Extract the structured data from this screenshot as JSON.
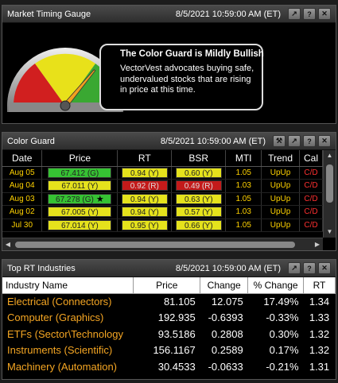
{
  "panels": {
    "gauge": {
      "title": "Market Timing Gauge",
      "timestamp": "8/5/2021 10:59:00 AM (ET)",
      "headline": "The Color Guard is Mildly Bullish",
      "body": "VectorVest advocates buying safe, undervalued stocks that are rising in price at this time.",
      "zones": [
        "red",
        "yellow",
        "green"
      ],
      "needle_level": 0.72
    },
    "color_guard": {
      "title": "Color Guard",
      "timestamp": "8/5/2021 10:59:00 AM (ET)",
      "columns": [
        "Date",
        "Price",
        "RT",
        "BSR",
        "MTI",
        "Trend",
        "Cal"
      ],
      "rows": [
        {
          "date": "Aug 05",
          "price": "67.412 (G)",
          "price_c": "g",
          "star": "",
          "rt": "0.94 (Y)",
          "rt_c": "y",
          "bsr": "0.60 (Y)",
          "bsr_c": "y",
          "mti": "1.05",
          "trend": "UpUp",
          "cal": "C/D"
        },
        {
          "date": "Aug 04",
          "price": "67.011 (Y)",
          "price_c": "y",
          "star": "",
          "rt": "0.92 (R)",
          "rt_c": "r",
          "bsr": "0.49 (R)",
          "bsr_c": "r",
          "mti": "1.03",
          "trend": "UpUp",
          "cal": "C/D"
        },
        {
          "date": "Aug 03",
          "price": "67.278 (G)",
          "price_c": "g",
          "star": "★",
          "rt": "0.94 (Y)",
          "rt_c": "y",
          "bsr": "0.63 (Y)",
          "bsr_c": "y",
          "mti": "1.05",
          "trend": "UpUp",
          "cal": "C/D"
        },
        {
          "date": "Aug 02",
          "price": "67.005 (Y)",
          "price_c": "y",
          "star": "",
          "rt": "0.94 (Y)",
          "rt_c": "y",
          "bsr": "0.57 (Y)",
          "bsr_c": "y",
          "mti": "1.03",
          "trend": "UpUp",
          "cal": "C/D"
        },
        {
          "date": "Jul 30",
          "price": "67.014 (Y)",
          "price_c": "y",
          "star": "",
          "rt": "0.95 (Y)",
          "rt_c": "y",
          "bsr": "0.66 (Y)",
          "bsr_c": "y",
          "mti": "1.05",
          "trend": "UpUp",
          "cal": "C/D"
        }
      ]
    },
    "industries": {
      "title": "Top RT Industries",
      "timestamp": "8/5/2021 10:59:00 AM (ET)",
      "columns": [
        "Industry Name",
        "Price",
        "Change",
        "% Change",
        "RT"
      ],
      "rows": [
        {
          "name": "Electrical (Connectors)",
          "price": "81.105",
          "change": "12.075",
          "pct": "17.49%",
          "rt": "1.34",
          "dir": "pos"
        },
        {
          "name": "Computer (Graphics)",
          "price": "192.935",
          "change": "-0.6393",
          "pct": "-0.33%",
          "rt": "1.33",
          "dir": "neg"
        },
        {
          "name": "ETFs (Sector\\Technology",
          "price": "93.5186",
          "change": "0.2808",
          "pct": "0.30%",
          "rt": "1.32",
          "dir": "pos"
        },
        {
          "name": "Instruments (Scientific)",
          "price": "156.1167",
          "change": "0.2589",
          "pct": "0.17%",
          "rt": "1.32",
          "dir": "pos"
        },
        {
          "name": "Machinery (Automation)",
          "price": "30.4533",
          "change": "-0.0633",
          "pct": "-0.21%",
          "rt": "1.31",
          "dir": "neg"
        }
      ]
    }
  },
  "title_buttons": [
    "pin-icon",
    "help-icon",
    "close-icon"
  ],
  "colors": {
    "green": "#36c233",
    "yellow": "#e5e21c",
    "red": "#c41a1a",
    "industry_name": "#f5a623"
  }
}
